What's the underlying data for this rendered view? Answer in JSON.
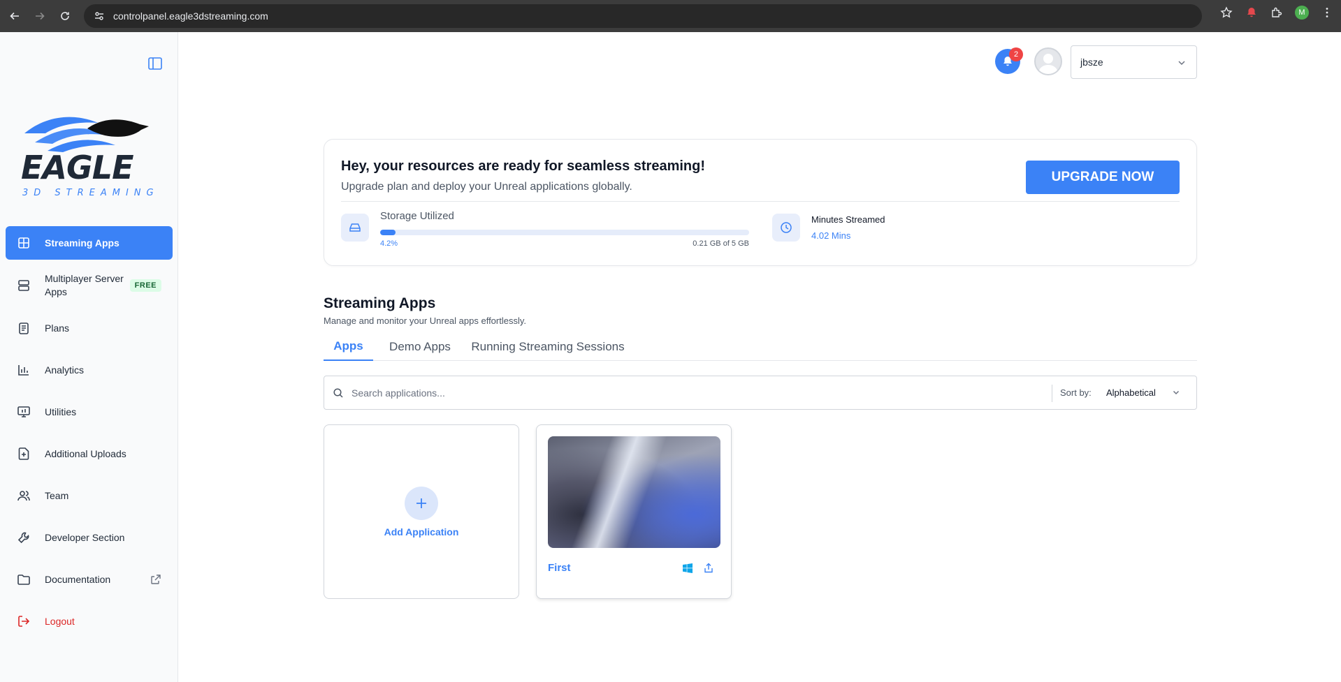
{
  "browser": {
    "url": "controlpanel.eagle3dstreaming.com",
    "profile_initial": "M"
  },
  "sidebar": {
    "items": [
      {
        "label": "Streaming Apps",
        "icon": "grid-icon",
        "active": true
      },
      {
        "label": "Multiplayer Server Apps",
        "icon": "server-icon",
        "badge": "FREE"
      },
      {
        "label": "Plans",
        "icon": "clipboard-icon"
      },
      {
        "label": "Analytics",
        "icon": "bar-chart-icon"
      },
      {
        "label": "Utilities",
        "icon": "monitor-icon"
      },
      {
        "label": "Additional Uploads",
        "icon": "file-plus-icon"
      },
      {
        "label": "Team",
        "icon": "users-icon"
      },
      {
        "label": "Developer Section",
        "icon": "wrench-icon"
      },
      {
        "label": "Documentation",
        "icon": "folder-icon"
      },
      {
        "label": "Logout",
        "icon": "logout-icon"
      }
    ]
  },
  "header": {
    "notification_count": "2",
    "username": "jbsze"
  },
  "resources": {
    "title": "Hey, your resources are ready for seamless streaming!",
    "subtitle": "Upgrade plan and deploy your Unreal applications globally.",
    "upgrade_label": "UPGRADE NOW",
    "storage_label": "Storage Utilized",
    "storage_percent_text": "4.2%",
    "storage_fraction": 0.042,
    "storage_amount": "0.21 GB of 5 GB",
    "minutes_label": "Minutes Streamed",
    "minutes_value": "4.02 Mins"
  },
  "apps_section": {
    "title": "Streaming Apps",
    "subtitle": "Manage and monitor your Unreal apps effortlessly.",
    "tabs": [
      {
        "label": "Apps",
        "active": true
      },
      {
        "label": "Demo Apps"
      },
      {
        "label": "Running Streaming Sessions"
      }
    ],
    "search_placeholder": "Search applications...",
    "sort_label": "Sort by:",
    "sort_value": "Alphabetical",
    "add_label": "Add Application",
    "apps": [
      {
        "name": "First",
        "platform_icon": "windows-icon"
      }
    ]
  },
  "colors": {
    "accent": "#3b82f6",
    "danger": "#dc2626",
    "free_badge_bg": "#dcfce7"
  }
}
